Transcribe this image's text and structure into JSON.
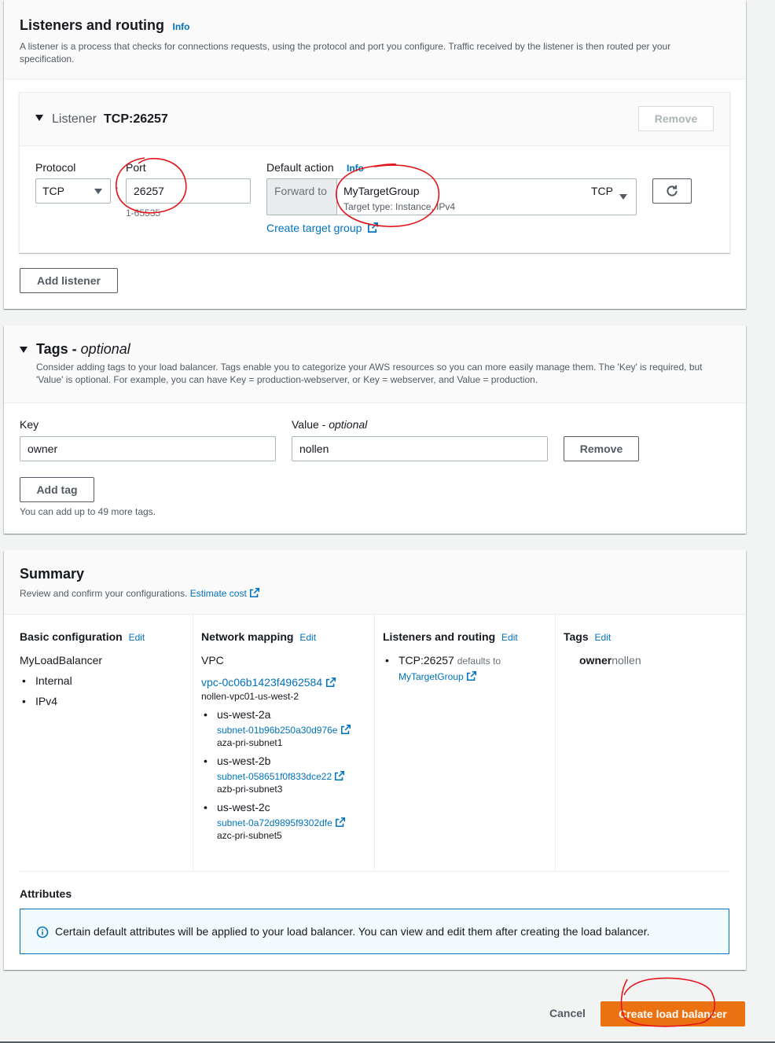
{
  "listeners": {
    "title": "Listeners and routing",
    "info": "Info",
    "description": "A listener is a process that checks for connections requests, using the protocol and port you configure. Traffic received by the listener is then routed per your specification.",
    "listener_label": "Listener",
    "listener_value": "TCP:26257",
    "remove_label": "Remove",
    "protocol_label": "Protocol",
    "protocol_value": "TCP",
    "port_label": "Port",
    "port_value": "26257",
    "port_hint": "1-65535",
    "colon": ":",
    "default_action_label": "Default action",
    "default_action_info": "Info",
    "forward_to": "Forward to",
    "target_group": "MyTargetGroup",
    "target_type": "Target type: Instance, IPv4",
    "target_protocol": "TCP",
    "create_target_group": "Create target group",
    "add_listener": "Add listener"
  },
  "tags": {
    "title": "Tags - ",
    "title_optional": "optional",
    "description": "Consider adding tags to your load balancer. Tags enable you to categorize your AWS resources so you can more easily manage them. The 'Key' is required, but 'Value' is optional. For example, you can have Key = production-webserver, or Key = webserver, and Value = production.",
    "key_label": "Key",
    "value_label": "Value - ",
    "value_optional": "optional",
    "key_value": "owner",
    "value_value": "nollen",
    "remove_label": "Remove",
    "add_tag": "Add tag",
    "hint": "You can add up to 49 more tags."
  },
  "summary": {
    "title": "Summary",
    "description": "Review and confirm your configurations.",
    "estimate_cost": "Estimate cost",
    "edit": "Edit",
    "basic": {
      "title": "Basic configuration",
      "name": "MyLoadBalancer",
      "scheme": "Internal",
      "ip_type": "IPv4"
    },
    "network": {
      "title": "Network mapping",
      "vpc_label": "VPC",
      "vpc_id": "vpc-0c06b1423f4962584",
      "vpc_name": "nollen-vpc01-us-west-2",
      "zones": [
        {
          "az": "us-west-2a",
          "subnet": "subnet-01b96b250a30d976e",
          "name": "aza-pri-subnet1"
        },
        {
          "az": "us-west-2b",
          "subnet": "subnet-058651f0f833dce22",
          "name": "azb-pri-subnet3"
        },
        {
          "az": "us-west-2c",
          "subnet": "subnet-0a72d9895f9302dfe",
          "name": "azc-pri-subnet5"
        }
      ]
    },
    "routing": {
      "title": "Listeners and routing",
      "listener": "TCP:26257",
      "defaults_to": "defaults to",
      "target": "MyTargetGroup"
    },
    "tags": {
      "title": "Tags",
      "key": "owner",
      "value": "nollen"
    },
    "attributes": {
      "title": "Attributes",
      "info_text": "Certain default attributes will be applied to your load balancer. You can view and edit them after creating the load balancer."
    }
  },
  "footer": {
    "cancel": "Cancel",
    "create": "Create load balancer"
  },
  "colors": {
    "primary_button": "#ec7211",
    "link": "#0073bb",
    "annotation_red": "#e3141b",
    "info_box_border": "#0073bb",
    "info_box_bg": "#f1faff"
  }
}
